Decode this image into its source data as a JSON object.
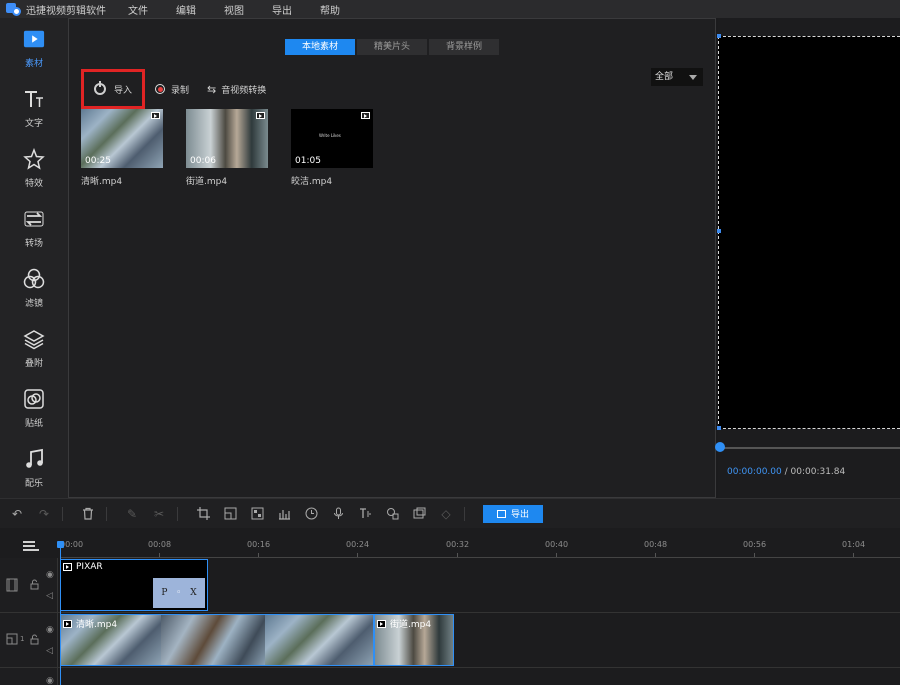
{
  "app": {
    "title": "迅捷视频剪辑软件",
    "menu": [
      "文件",
      "编辑",
      "视图",
      "导出",
      "帮助"
    ]
  },
  "sidebar": {
    "items": [
      {
        "label": "素材",
        "icon": "folder-icon",
        "active": true
      },
      {
        "label": "文字",
        "icon": "text-icon",
        "active": false
      },
      {
        "label": "特效",
        "icon": "effects-star-icon",
        "active": false
      },
      {
        "label": "转场",
        "icon": "transition-icon",
        "active": false
      },
      {
        "label": "滤镜",
        "icon": "filter-circles-icon",
        "active": false
      },
      {
        "label": "叠附",
        "icon": "overlay-layers-icon",
        "active": false
      },
      {
        "label": "贴纸",
        "icon": "sticker-icon",
        "active": false
      },
      {
        "label": "配乐",
        "icon": "music-note-icon",
        "active": false
      }
    ]
  },
  "media": {
    "tabs": [
      "本地素材",
      "精美片头",
      "背景样例"
    ],
    "active_tab": 0,
    "toolbar": {
      "import": "导入",
      "record": "录制",
      "convert": "音视频转换"
    },
    "filter": "全部",
    "items": [
      {
        "name": "清晰.mp4",
        "duration": "00:25",
        "style": "frost"
      },
      {
        "name": "街道.mp4",
        "duration": "00:06",
        "style": "street"
      },
      {
        "name": "皎洁.mp4",
        "duration": "01:05",
        "style": "black",
        "caption": "Write Likes"
      }
    ]
  },
  "preview": {
    "current_time": "00:00:00.00",
    "total_time": "/ 00:00:31.84"
  },
  "edit_toolbar": {
    "export": "导出"
  },
  "timeline": {
    "ruler": [
      "00:00",
      "00:08",
      "00:16",
      "00:24",
      "00:32",
      "00:40",
      "00:48",
      "00:56",
      "01:04"
    ],
    "track_number": "1",
    "clips": {
      "pixar": {
        "label": "PIXAR",
        "letters": [
          "P",
          "X"
        ]
      },
      "video1": {
        "label": "清晰.mp4"
      },
      "video2": {
        "label": "街道.mp4"
      }
    }
  },
  "colors": {
    "accent": "#1e88f0",
    "highlight_box": "#e02424",
    "panel": "#1f1f21"
  }
}
